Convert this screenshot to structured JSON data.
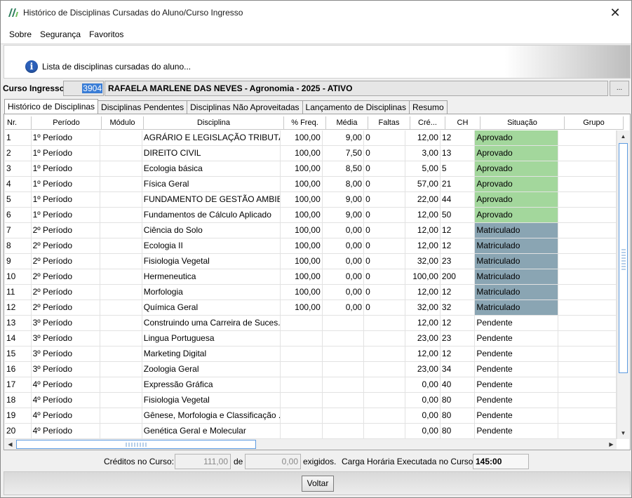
{
  "window": {
    "title": "Histórico de Disciplinas Cursadas do Aluno/Curso Ingresso",
    "close_symbol": "✕"
  },
  "menu": [
    "Sobre",
    "Segurança",
    "Favoritos"
  ],
  "info": {
    "icon": "info-icon",
    "text": "Lista de disciplinas cursadas do aluno..."
  },
  "curso": {
    "label": "Curso Ingresso:",
    "code": "3904",
    "name": "RAFAELA MARLENE DAS NEVES - Agronomia - 2025 - ATIVO",
    "button": "..."
  },
  "tabs": [
    "Histórico de Disciplinas",
    "Disciplinas Pendentes",
    "Disciplinas Não Aproveitadas",
    "Lançamento de Disciplinas",
    "Resumo"
  ],
  "grid": {
    "columns": [
      "Nr.",
      "Período",
      "Módulo",
      "Disciplina",
      "% Freq.",
      "Média",
      "Faltas",
      "Cré...",
      "CH",
      "Situação",
      "Grupo"
    ],
    "rows": [
      [
        "1",
        "1º Período",
        "",
        "AGRÁRIO E LEGISLAÇÃO TRIBUTÁRIA",
        "100,00",
        "9,00",
        "0",
        "12,00",
        "12",
        "Aprovado"
      ],
      [
        "2",
        "1º Período",
        "",
        "DIREITO CIVIL",
        "100,00",
        "7,50",
        "0",
        "3,00",
        "13",
        "Aprovado"
      ],
      [
        "3",
        "1º Período",
        "",
        "Ecologia básica",
        "100,00",
        "8,50",
        "0",
        "5,00",
        "5",
        "Aprovado"
      ],
      [
        "4",
        "1º Período",
        "",
        "Física Geral",
        "100,00",
        "8,00",
        "0",
        "57,00",
        "21",
        "Aprovado"
      ],
      [
        "5",
        "1º Período",
        "",
        "FUNDAMENTO DE GESTÃO AMBIE...",
        "100,00",
        "9,00",
        "0",
        "22,00",
        "44",
        "Aprovado"
      ],
      [
        "6",
        "1º Período",
        "",
        "Fundamentos de Cálculo Aplicado",
        "100,00",
        "9,00",
        "0",
        "12,00",
        "50",
        "Aprovado"
      ],
      [
        "7",
        "2º Período",
        "",
        "Ciência do Solo",
        "100,00",
        "0,00",
        "0",
        "12,00",
        "12",
        "Matriculado"
      ],
      [
        "8",
        "2º Período",
        "",
        "Ecologia II",
        "100,00",
        "0,00",
        "0",
        "12,00",
        "12",
        "Matriculado"
      ],
      [
        "9",
        "2º Período",
        "",
        "Fisiologia Vegetal",
        "100,00",
        "0,00",
        "0",
        "32,00",
        "23",
        "Matriculado"
      ],
      [
        "10",
        "2º Período",
        "",
        "Hermeneutica",
        "100,00",
        "0,00",
        "0",
        "100,00",
        "200",
        "Matriculado"
      ],
      [
        "11",
        "2º Período",
        "",
        "Morfologia",
        "100,00",
        "0,00",
        "0",
        "12,00",
        "12",
        "Matriculado"
      ],
      [
        "12",
        "2º Período",
        "",
        "Química Geral",
        "100,00",
        "0,00",
        "0",
        "32,00",
        "32",
        "Matriculado"
      ],
      [
        "13",
        "3º Período",
        "",
        "Construindo uma Carreira de Suces...",
        "",
        "",
        "",
        "12,00",
        "12",
        "Pendente"
      ],
      [
        "14",
        "3º Período",
        "",
        "Lingua Portuguesa",
        "",
        "",
        "",
        "23,00",
        "23",
        "Pendente"
      ],
      [
        "15",
        "3º Período",
        "",
        "Marketing Digital",
        "",
        "",
        "",
        "12,00",
        "12",
        "Pendente"
      ],
      [
        "16",
        "3º Período",
        "",
        "Zoologia Geral",
        "",
        "",
        "",
        "23,00",
        "34",
        "Pendente"
      ],
      [
        "17",
        "4º Período",
        "",
        "Expressão Gráfica",
        "",
        "",
        "",
        "0,00",
        "40",
        "Pendente"
      ],
      [
        "18",
        "4º Período",
        "",
        "Fisiologia Vegetal",
        "",
        "",
        "",
        "0,00",
        "80",
        "Pendente"
      ],
      [
        "19",
        "4º Período",
        "",
        "Gênese, Morfologia e Classificação ...",
        "",
        "",
        "",
        "0,00",
        "80",
        "Pendente"
      ],
      [
        "20",
        "4º Período",
        "",
        "Genética Geral e Molecular",
        "",
        "",
        "",
        "0,00",
        "80",
        "Pendente"
      ]
    ]
  },
  "status_colors": {
    "Aprovado": "#a3d79c",
    "Matriculado": "#8aa5b3",
    "Pendente": "#ffffff"
  },
  "footer": {
    "creditos_label": "Créditos no Curso:",
    "creditos_value": "111,00",
    "de_label": "de",
    "exigidos_value": "0,00",
    "exigidos_label": "exigidos.",
    "carga_label": "Carga Horária Executada no Curso:",
    "carga_value": "145:00"
  },
  "buttons": {
    "voltar": "Voltar"
  }
}
